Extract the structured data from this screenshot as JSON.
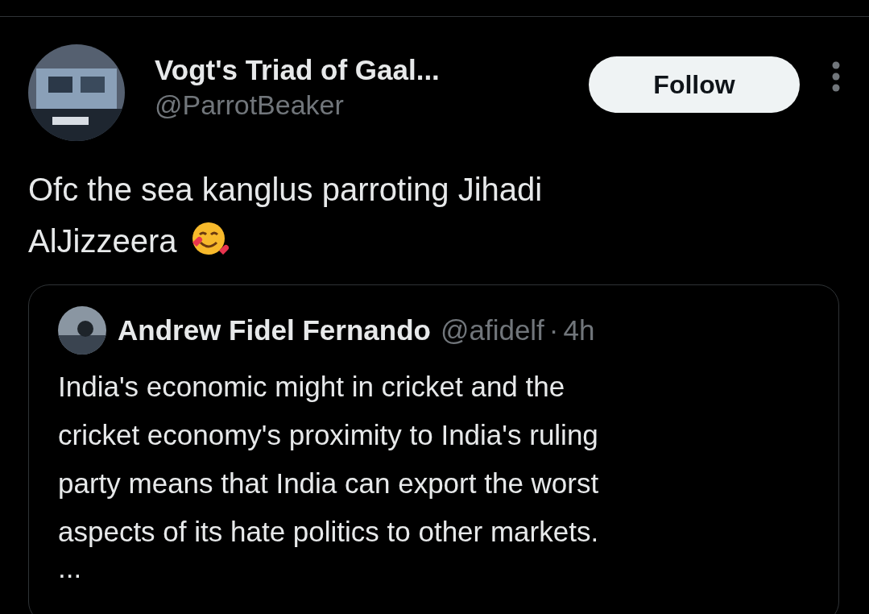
{
  "post": {
    "author": {
      "name": "Vogt's Triad of Gaal...",
      "handle": "@ParrotBeaker"
    },
    "follow_button": "Follow",
    "text_lines": [
      "Ofc the sea kanglus parroting Jihadi",
      "AlJizzeera"
    ],
    "quoted_post": {
      "author": {
        "name": "Andrew Fidel Fernando",
        "handle": "@afidelf"
      },
      "separator": "·",
      "time": "4h",
      "text_lines": [
        "India's economic might in cricket and the",
        "cricket economy's proximity to India's ruling",
        "party means that India can export the worst",
        "aspects of its hate politics to other markets."
      ],
      "more": "..."
    }
  }
}
